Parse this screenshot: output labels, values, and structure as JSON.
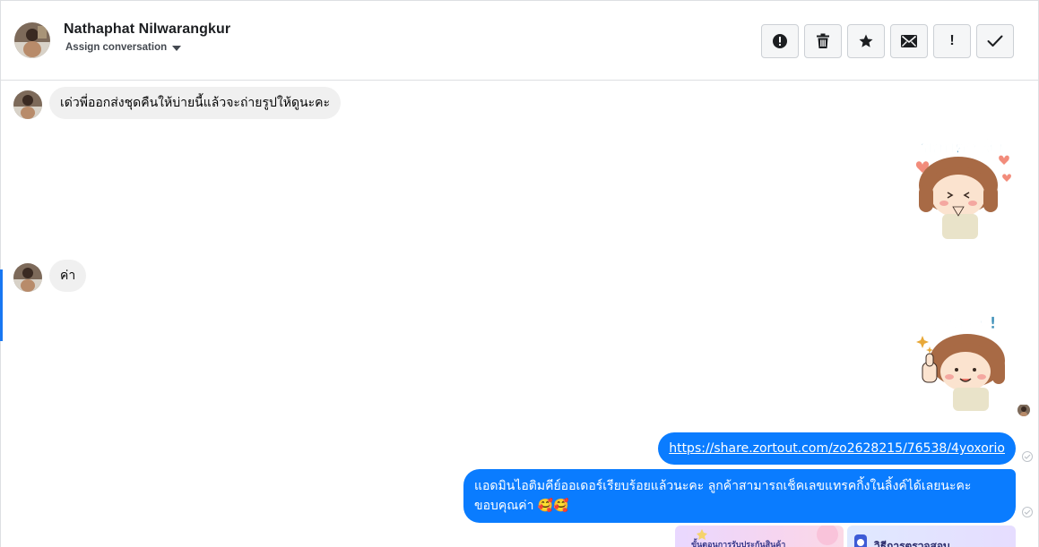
{
  "header": {
    "contact_name": "Nathaphat Nilwarangkur",
    "assign_label": "Assign conversation",
    "actions": [
      {
        "icon": "alert-circle-icon",
        "label": "Mark as spam"
      },
      {
        "icon": "trash-icon",
        "label": "Delete"
      },
      {
        "icon": "star-icon",
        "label": "Star"
      },
      {
        "icon": "envelope-icon",
        "label": "Mark as unread"
      },
      {
        "icon": "exclamation-icon",
        "label": "Follow up"
      },
      {
        "icon": "checkmark-icon",
        "label": "Mark as done"
      }
    ]
  },
  "thread": {
    "messages": [
      {
        "direction": "incoming",
        "type": "text",
        "text": "เด่วพี่ออกส่งชุดคืนให้บ่ายนี้แล้วจะถ่ายรูปให้ดูนะคะ"
      },
      {
        "direction": "outgoing",
        "type": "sticker",
        "text": "ขอบคุณจ้า"
      },
      {
        "direction": "incoming",
        "type": "text",
        "text": "ค่า"
      },
      {
        "direction": "outgoing",
        "type": "sticker",
        "text": "แจ่มเลย!"
      },
      {
        "direction": "outgoing",
        "type": "link",
        "text": "https://share.zortout.com/zo2628215/76538/4yoxorio"
      },
      {
        "direction": "outgoing",
        "type": "text",
        "text": "แอดมินไอติมคีย์ออเดอร์เรียบร้อยแล้วนะคะ ลูกค้าสามารถเช็คเลขแทรคกิ้งในลิ้งค์ได้เลยนะคะ ขอบคุณค่า 🥰🥰"
      },
      {
        "direction": "outgoing",
        "type": "image-thumbnails",
        "captions": [
          "ขั้นตอนการรับประกันสินค้า",
          "วิธีการตรวจสอบ"
        ]
      }
    ]
  },
  "colors": {
    "outgoing_bubble": "#0a7cff",
    "incoming_bubble": "#f0f0f0",
    "active_indicator": "#1877f2"
  }
}
